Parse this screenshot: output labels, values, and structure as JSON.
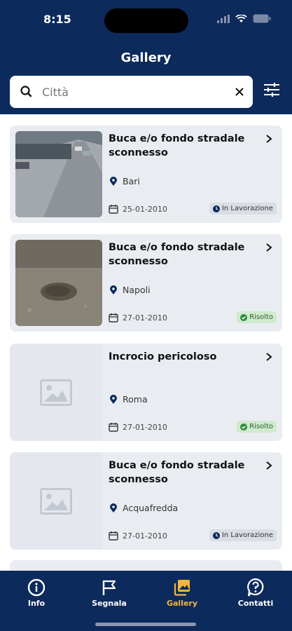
{
  "status": {
    "time": "8:15"
  },
  "header": {
    "title": "Gallery"
  },
  "search": {
    "placeholder": "Città",
    "value": ""
  },
  "cards": [
    {
      "title": "Buca e/o fondo stradale sconnesso",
      "city": "Bari",
      "date": "25-01-2010",
      "status": "In Lavorazione",
      "image": "street-photo"
    },
    {
      "title": "Buca e/o fondo stradale sconnesso",
      "city": "Napoli",
      "date": "27-01-2010",
      "status": "Risolto",
      "image": "pothole-photo"
    },
    {
      "title": "Incrocio pericoloso",
      "city": "Roma",
      "date": "27-01-2010",
      "status": "Risolto",
      "image": "placeholder"
    },
    {
      "title": "Buca e/o fondo stradale sconnesso",
      "city": "Acquafredda",
      "date": "27-01-2010",
      "status": "In Lavorazione",
      "image": "placeholder"
    }
  ],
  "tabs": [
    {
      "label": "Info",
      "icon": "info-icon"
    },
    {
      "label": "Segnala",
      "icon": "flag-icon"
    },
    {
      "label": "Gallery",
      "icon": "gallery-icon",
      "active": true
    },
    {
      "label": "Contatti",
      "icon": "help-icon"
    }
  ],
  "colors": {
    "primary": "#0d2a5c",
    "accent": "#f6b53c",
    "card": "#e9edf2",
    "resolved": "#cfeacf"
  }
}
